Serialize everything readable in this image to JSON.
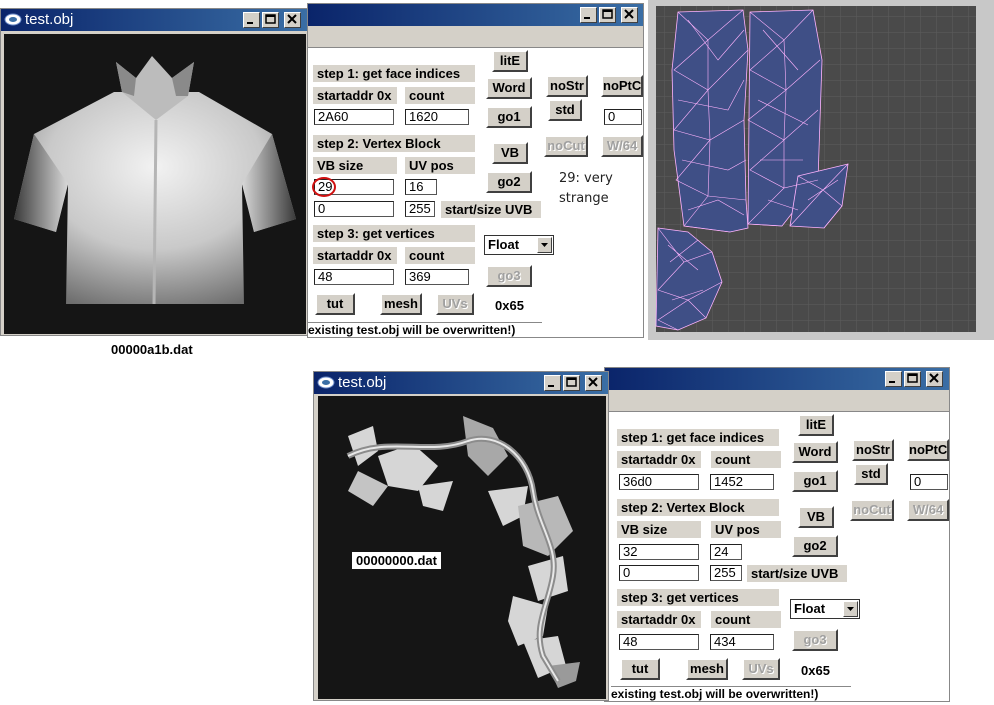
{
  "win1": {
    "viewer_title": "test.obj",
    "caption": "00000a1b.dat",
    "step1": "step 1: get face indices",
    "startaddr_lbl": "startaddr 0x",
    "count_lbl": "count",
    "startaddr": "2A60",
    "count": "1620",
    "step2": "step 2: Vertex Block",
    "vbsize_lbl": "VB size",
    "uvpos_lbl": "UV pos",
    "vbsize": "29",
    "uvpos": "16",
    "uvb_start": "0",
    "uvb_size": "255",
    "uvb_lbl": "start/size UVB",
    "step3": "step 3: get vertices",
    "startaddr3_lbl": "startaddr 0x",
    "count3_lbl": "count",
    "startaddr3": "48",
    "count3": "369",
    "btn_lite": "litE",
    "btn_word": "Word",
    "btn_go1": "go1",
    "btn_vb": "VB",
    "btn_go2": "go2",
    "btn_go3": "go3",
    "btn_nostr": "noStr",
    "btn_noptc": "noPtC",
    "btn_std": "std",
    "btn_nocut": "noCut",
    "btn_w64": "W/64",
    "field_zero": "0",
    "format": "Float",
    "btn_tut": "tut",
    "btn_mesh": "mesh",
    "btn_uvs": "UVs",
    "hex": "0x65",
    "note": "29: very strange",
    "status": "existing test.obj will be overwritten!)"
  },
  "win2": {
    "viewer_title": "test.obj",
    "caption": "00000000.dat",
    "step1": "step 1: get face indices",
    "startaddr_lbl": "startaddr 0x",
    "count_lbl": "count",
    "startaddr": "36d0",
    "count": "1452",
    "step2": "step 2: Vertex Block",
    "vbsize_lbl": "VB size",
    "uvpos_lbl": "UV pos",
    "vbsize": "32",
    "uvpos": "24",
    "uvb_start": "0",
    "uvb_size": "255",
    "uvb_lbl": "start/size UVB",
    "step3": "step 3: get vertices",
    "startaddr3_lbl": "startaddr 0x",
    "count3_lbl": "count",
    "startaddr3": "48",
    "count3": "434",
    "btn_lite": "litE",
    "btn_word": "Word",
    "btn_go1": "go1",
    "btn_vb": "VB",
    "btn_go2": "go2",
    "btn_go3": "go3",
    "btn_nostr": "noStr",
    "btn_noptc": "noPtC",
    "btn_std": "std",
    "btn_nocut": "noCut",
    "btn_w64": "W/64",
    "field_zero": "0",
    "format": "Float",
    "btn_tut": "tut",
    "btn_mesh": "mesh",
    "btn_uvs": "UVs",
    "hex": "0x65",
    "status": "existing test.obj will be overwritten!)"
  },
  "colors": {
    "titlebar_start": "#0a246a",
    "titlebar_end": "#3a6ea5",
    "uv_fill": "#3f4f86",
    "uv_edge": "#ffb3ff",
    "highlight_circle": "#d01010"
  },
  "icons": [
    "minimize-icon",
    "maximize-icon",
    "close-icon",
    "app-icon",
    "dropdown-arrow-icon"
  ]
}
